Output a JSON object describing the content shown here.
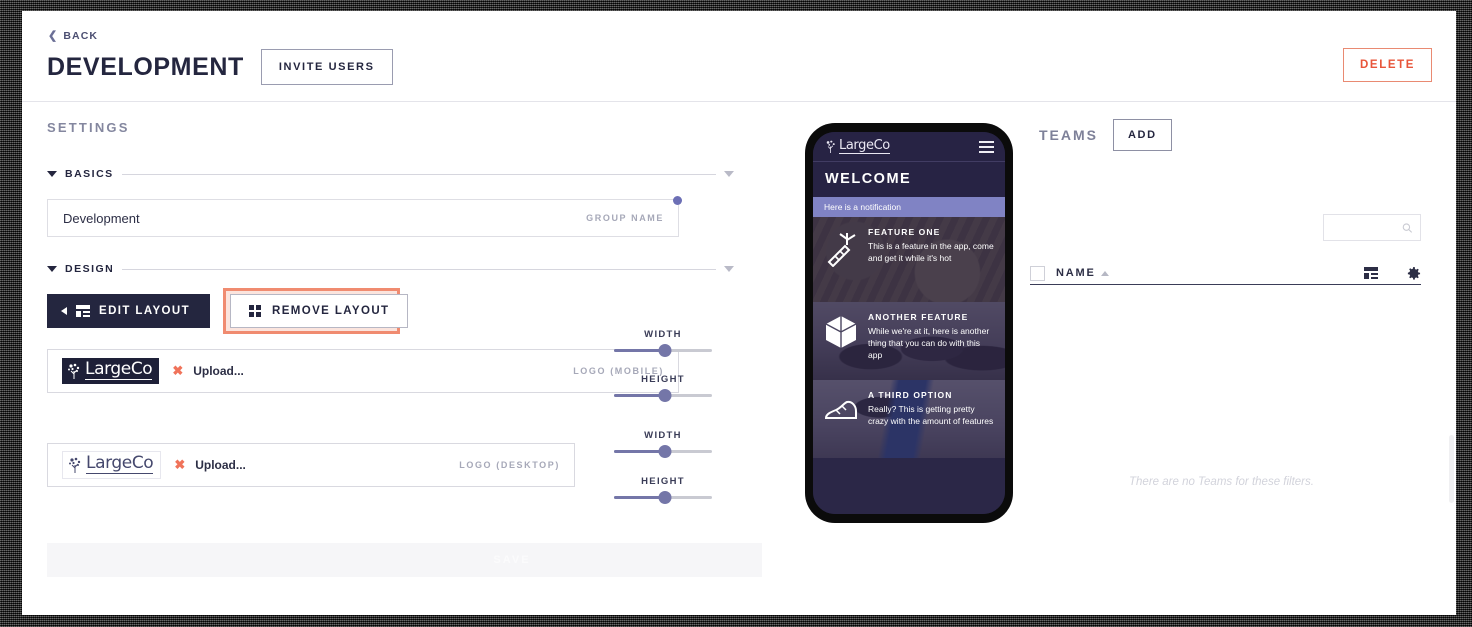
{
  "header": {
    "back_label": "BACK",
    "title": "DEVELOPMENT",
    "invite_users_label": "INVITE USERS",
    "delete_label": "DELETE"
  },
  "settings": {
    "heading": "SETTINGS",
    "sections": [
      {
        "label": "BASICS"
      },
      {
        "label": "DESIGN"
      }
    ],
    "group_name_field": {
      "value": "Development",
      "label": "GROUP NAME"
    },
    "layout_buttons": {
      "edit_label": "EDIT LAYOUT",
      "remove_label": "REMOVE LAYOUT",
      "highlighted": "REMOVE LAYOUT"
    },
    "logos": [
      {
        "brand_text": "LargeCo",
        "remove_glyph": "✖",
        "upload_label": "Upload...",
        "field_label": "LOGO (MOBILE)",
        "variant": "dark"
      },
      {
        "brand_text": "LargeCo",
        "remove_glyph": "✖",
        "upload_label": "Upload...",
        "field_label": "LOGO (DESKTOP)",
        "variant": "light"
      }
    ],
    "sliders": [
      {
        "label": "WIDTH",
        "percent": 52
      },
      {
        "label": "HEIGHT",
        "percent": 52
      },
      {
        "label": "WIDTH",
        "percent": 52
      },
      {
        "label": "HEIGHT",
        "percent": 52
      }
    ],
    "save_label": "SAVE"
  },
  "phone_preview": {
    "brand_text": "LargeCo",
    "menu_icon": "hamburger-icon",
    "welcome_title": "WELCOME",
    "notification": "Here is a notification",
    "features": [
      {
        "icon": "carrot-icon",
        "title": "FEATURE ONE",
        "description": "This is a feature in the app, come and get it while it's hot"
      },
      {
        "icon": "box-icon",
        "title": "ANOTHER FEATURE",
        "description": "While we're at it, here is another thing that you can do with this app"
      },
      {
        "icon": "shoe-icon",
        "title": "A THIRD OPTION",
        "description": "Really? This is getting pretty crazy with the amount of features"
      }
    ]
  },
  "teams": {
    "title": "TEAMS",
    "add_label": "ADD",
    "search_placeholder": "",
    "search_value": "",
    "columns": [
      "NAME"
    ],
    "sort_direction": "asc",
    "empty_message": "There are no Teams for these filters.",
    "rows": []
  },
  "colors": {
    "navy": "#24263f",
    "accent_red": "#e8553a",
    "highlight_ring": "#f08b70",
    "slider_purple": "#7476a8",
    "notification_purple": "#8083c4",
    "phone_bg": "#2b2747",
    "muted_gray": "#84879f"
  }
}
